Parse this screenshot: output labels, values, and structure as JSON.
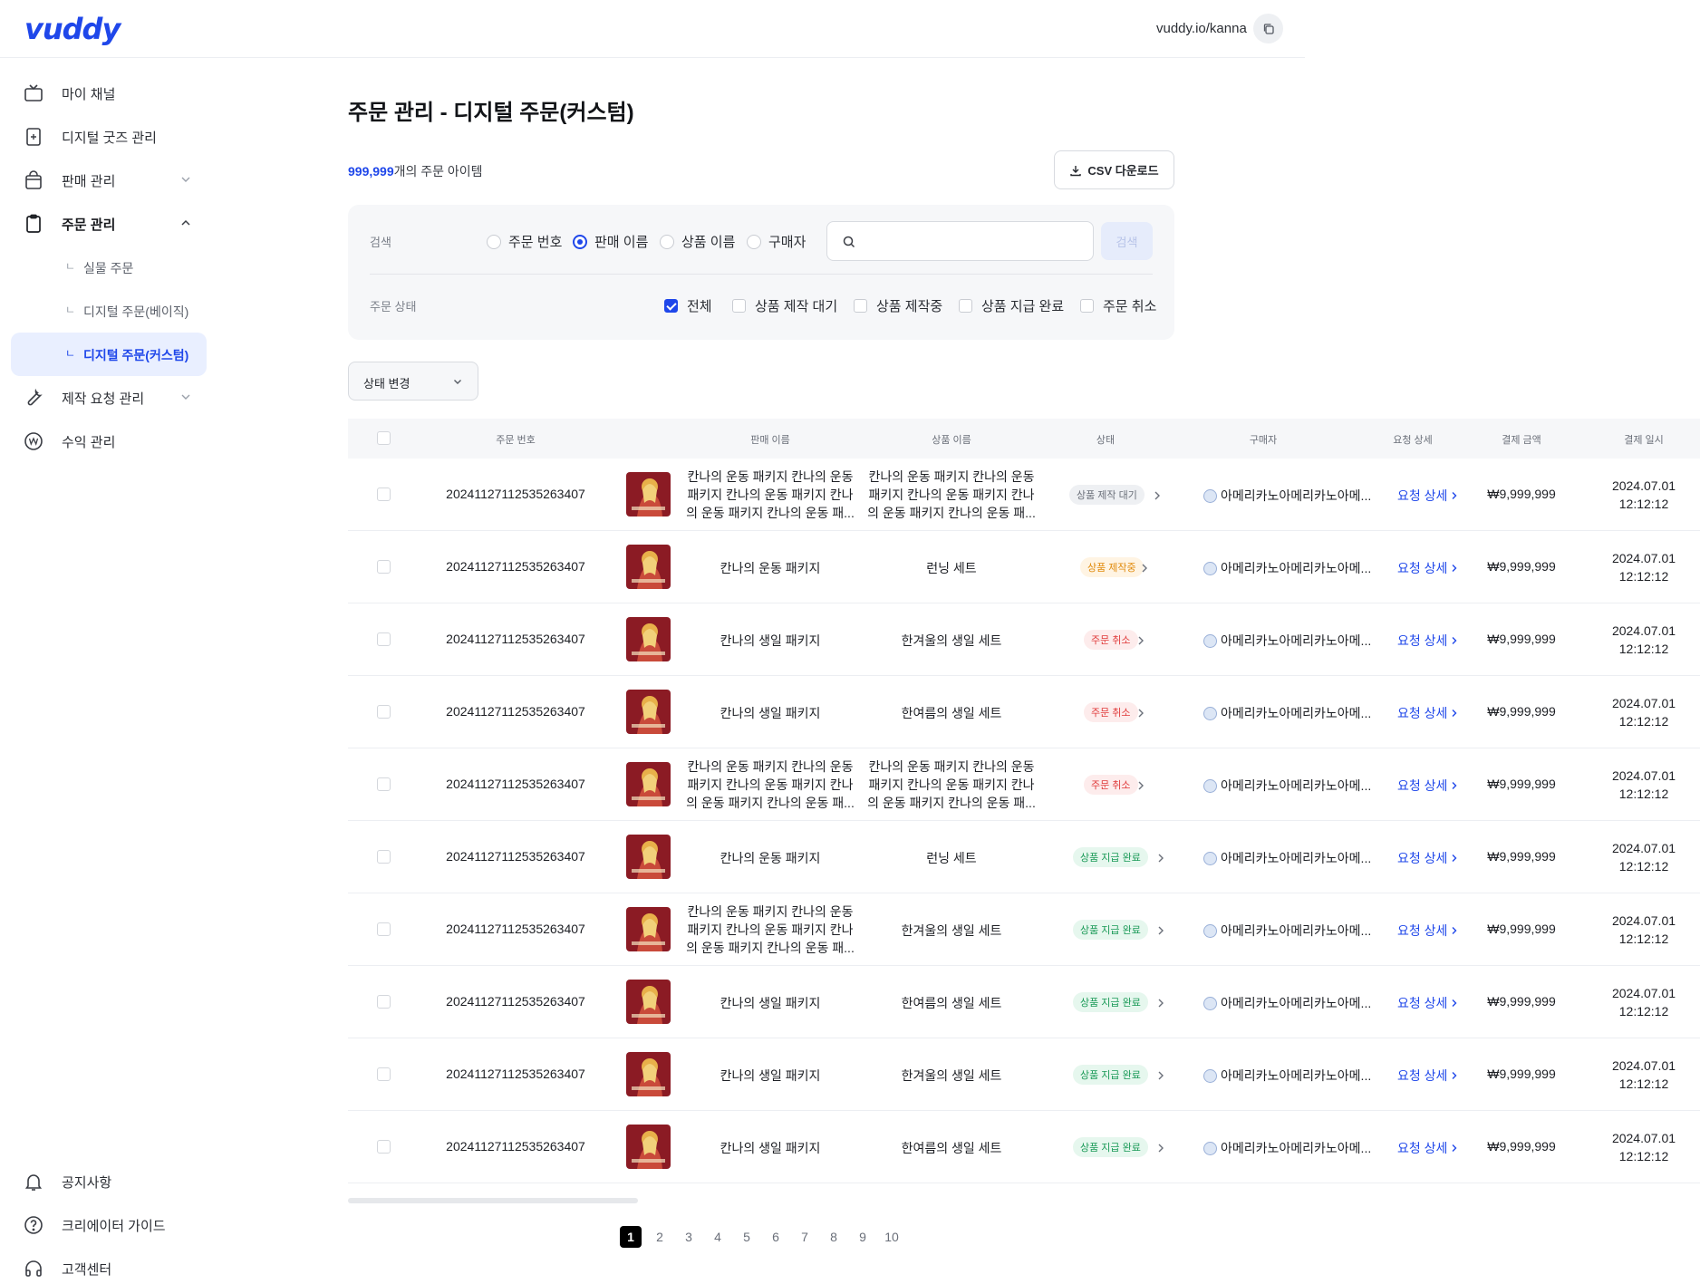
{
  "header": {
    "logo": "vuddy",
    "channel_url": "vuddy.io/kanna"
  },
  "sidebar": {
    "items": [
      {
        "label": "마이 채널",
        "icon": "tv-icon"
      },
      {
        "label": "디지털 굿즈 관리",
        "icon": "digital-goods-icon"
      },
      {
        "label": "판매 관리",
        "icon": "shopping-bag-icon"
      },
      {
        "label": "주문 관리",
        "icon": "clipboard-icon"
      },
      {
        "label": "제작 요청 관리",
        "icon": "wrench-icon"
      },
      {
        "label": "수익 관리",
        "icon": "won-coin-icon"
      }
    ],
    "sub_items": [
      {
        "label": "실물 주문"
      },
      {
        "label": "디지털 주문(베이직)"
      },
      {
        "label": "디지털 주문(커스텀)"
      }
    ],
    "sub_corner": "ㄴ",
    "bottom": [
      {
        "label": "공지사항",
        "icon": "bell-icon"
      },
      {
        "label": "크리에이터 가이드",
        "icon": "question-circle-icon"
      },
      {
        "label": "고객센터",
        "icon": "headset-icon"
      }
    ]
  },
  "main": {
    "title": "주문 관리 - 디지털 주문(커스텀)",
    "count_value": "999,999",
    "count_suffix": "개의 주문 아이템",
    "csv_button": "CSV 다운로드"
  },
  "filters": {
    "search_label": "검색",
    "radios": [
      "주문 번호",
      "판매 이름",
      "상품 이름",
      "구매자"
    ],
    "selected_radio": "판매 이름",
    "search_placeholder": "",
    "search_button": "검색",
    "status_label": "주문 상태",
    "checks": [
      "전체",
      "상품 제작 대기",
      "상품 제작중",
      "상품 지급 완료",
      "주문 취소"
    ],
    "checked": [
      "전체"
    ]
  },
  "status_change": "상태 변경",
  "table": {
    "columns": [
      "주문 번호",
      "판매 이름",
      "상품 이름",
      "상태",
      "구매자",
      "요청 상세",
      "결제 금액",
      "결제 일시"
    ],
    "rows": [
      {
        "order_no": "20241127112535263407",
        "sale_l1": "칸나의 운동 패키지 칸나의 운동",
        "sale_l2": "패키지 칸나의 운동 패키지 칸나",
        "sale_l3": "의 운동 패키지 칸나의 운동 패...",
        "product_l1": "칸나의 운동 패키지 칸나의 운동",
        "product_l2": "패키지 칸나의 운동 패키지 칸나",
        "product_l3": "의 운동 패키지 칸나의 운동 패...",
        "status": "상품 제작 대기",
        "status_type": "waiting",
        "buyer": "아메리카노아메리카노아메...",
        "detail": "요청 상세",
        "amount": "₩9,999,999",
        "date": "2024.07.01",
        "time": "12:12:12"
      },
      {
        "order_no": "20241127112535263407",
        "sale_l1": "칸나의 운동 패키지",
        "sale_l2": "",
        "sale_l3": "",
        "product_l1": "런닝 세트",
        "product_l2": "",
        "product_l3": "",
        "status": "상품 제작중",
        "status_type": "making",
        "buyer": "아메리카노아메리카노아메...",
        "detail": "요청 상세",
        "amount": "₩9,999,999",
        "date": "2024.07.01",
        "time": "12:12:12"
      },
      {
        "order_no": "20241127112535263407",
        "sale_l1": "칸나의 생일 패키지",
        "sale_l2": "",
        "sale_l3": "",
        "product_l1": "한겨울의 생일 세트",
        "product_l2": "",
        "product_l3": "",
        "status": "주문 취소",
        "status_type": "cancel",
        "buyer": "아메리카노아메리카노아메...",
        "detail": "요청 상세",
        "amount": "₩9,999,999",
        "date": "2024.07.01",
        "time": "12:12:12"
      },
      {
        "order_no": "20241127112535263407",
        "sale_l1": "칸나의 생일 패키지",
        "sale_l2": "",
        "sale_l3": "",
        "product_l1": "한여름의 생일 세트",
        "product_l2": "",
        "product_l3": "",
        "status": "주문 취소",
        "status_type": "cancel",
        "buyer": "아메리카노아메리카노아메...",
        "detail": "요청 상세",
        "amount": "₩9,999,999",
        "date": "2024.07.01",
        "time": "12:12:12"
      },
      {
        "order_no": "20241127112535263407",
        "sale_l1": "칸나의 운동 패키지 칸나의 운동",
        "sale_l2": "패키지 칸나의 운동 패키지 칸나",
        "sale_l3": "의 운동 패키지 칸나의 운동 패...",
        "product_l1": "칸나의 운동 패키지 칸나의 운동",
        "product_l2": "패키지 칸나의 운동 패키지 칸나",
        "product_l3": "의 운동 패키지 칸나의 운동 패...",
        "status": "주문 취소",
        "status_type": "cancel",
        "buyer": "아메리카노아메리카노아메...",
        "detail": "요청 상세",
        "amount": "₩9,999,999",
        "date": "2024.07.01",
        "time": "12:12:12"
      },
      {
        "order_no": "20241127112535263407",
        "sale_l1": "칸나의 운동 패키지",
        "sale_l2": "",
        "sale_l3": "",
        "product_l1": "런닝 세트",
        "product_l2": "",
        "product_l3": "",
        "status": "상품 지급 완료",
        "status_type": "done",
        "buyer": "아메리카노아메리카노아메...",
        "detail": "요청 상세",
        "amount": "₩9,999,999",
        "date": "2024.07.01",
        "time": "12:12:12"
      },
      {
        "order_no": "20241127112535263407",
        "sale_l1": "칸나의 운동 패키지 칸나의 운동",
        "sale_l2": "패키지 칸나의 운동 패키지 칸나",
        "sale_l3": "의 운동 패키지 칸나의 운동 패...",
        "product_l1": "한겨울의 생일 세트",
        "product_l2": "",
        "product_l3": "",
        "status": "상품 지급 완료",
        "status_type": "done",
        "buyer": "아메리카노아메리카노아메...",
        "detail": "요청 상세",
        "amount": "₩9,999,999",
        "date": "2024.07.01",
        "time": "12:12:12"
      },
      {
        "order_no": "20241127112535263407",
        "sale_l1": "칸나의 생일 패키지",
        "sale_l2": "",
        "sale_l3": "",
        "product_l1": "한여름의 생일 세트",
        "product_l2": "",
        "product_l3": "",
        "status": "상품 지급 완료",
        "status_type": "done",
        "buyer": "아메리카노아메리카노아메...",
        "detail": "요청 상세",
        "amount": "₩9,999,999",
        "date": "2024.07.01",
        "time": "12:12:12"
      },
      {
        "order_no": "20241127112535263407",
        "sale_l1": "칸나의 생일 패키지",
        "sale_l2": "",
        "sale_l3": "",
        "product_l1": "한겨울의 생일 세트",
        "product_l2": "",
        "product_l3": "",
        "status": "상품 지급 완료",
        "status_type": "done",
        "buyer": "아메리카노아메리카노아메...",
        "detail": "요청 상세",
        "amount": "₩9,999,999",
        "date": "2024.07.01",
        "time": "12:12:12"
      },
      {
        "order_no": "20241127112535263407",
        "sale_l1": "칸나의 생일 패키지",
        "sale_l2": "",
        "sale_l3": "",
        "product_l1": "한여름의 생일 세트",
        "product_l2": "",
        "product_l3": "",
        "status": "상품 지급 완료",
        "status_type": "done",
        "buyer": "아메리카노아메리카노아메...",
        "detail": "요청 상세",
        "amount": "₩9,999,999",
        "date": "2024.07.01",
        "time": "12:12:12"
      }
    ]
  },
  "pagination": {
    "pages": [
      "1",
      "2",
      "3",
      "4",
      "5",
      "6",
      "7",
      "8",
      "9",
      "10"
    ],
    "current": "1"
  },
  "colors": {
    "brand": "#1f47ea",
    "status_waiting": "#6a6f79",
    "status_making": "#e08a0b",
    "status_cancel": "#e03a3a",
    "status_done": "#1a9a57"
  }
}
